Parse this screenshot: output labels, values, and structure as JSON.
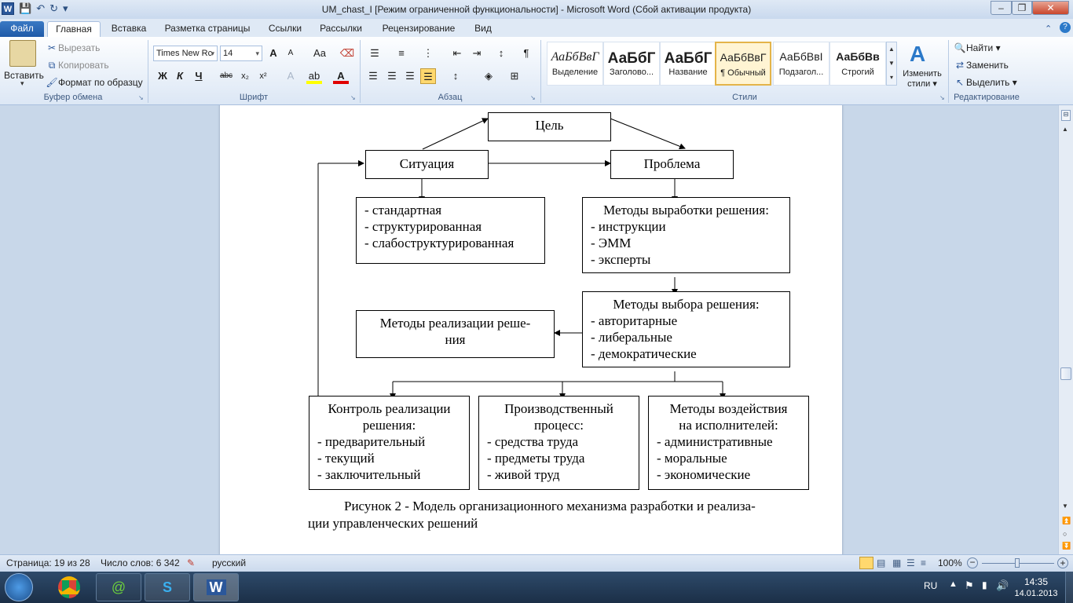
{
  "window": {
    "title": "UM_chast_I [Режим ограниченной функциональности]  -  Microsoft Word (Сбой активации продукта)",
    "app_logo": "W",
    "help": "?"
  },
  "tabs": [
    "Файл",
    "Главная",
    "Вставка",
    "Разметка страницы",
    "Ссылки",
    "Рассылки",
    "Рецензирование",
    "Вид"
  ],
  "ribbon": {
    "clipboard": {
      "paste": "Вставить",
      "cut": "Вырезать",
      "copy": "Копировать",
      "format_painter": "Формат по образцу",
      "label": "Буфер обмена"
    },
    "font": {
      "name": "Times New Rc",
      "size": "14",
      "label": "Шрифт",
      "bold": "Ж",
      "italic": "К",
      "underline": "Ч",
      "strike": "abc",
      "sub": "x₂",
      "sup": "x²",
      "grow": "A",
      "shrink": "A",
      "case": "Aa"
    },
    "paragraph": {
      "label": "Абзац",
      "pilcrow": "¶"
    },
    "styles": {
      "label": "Стили",
      "items": [
        {
          "preview": "АаБбВвГ",
          "name": "Выделение"
        },
        {
          "preview": "АаБбГ",
          "name": "Заголово..."
        },
        {
          "preview": "АаБбГ",
          "name": "Название"
        },
        {
          "preview": "АаБбВвГ",
          "name": "¶ Обычный"
        },
        {
          "preview": "АаБбВвІ",
          "name": "Подзагол..."
        },
        {
          "preview": "АаБбВв",
          "name": "Строгий"
        }
      ],
      "change_line1": "Изменить",
      "change_line2": "стили"
    },
    "editing": {
      "label": "Редактирование",
      "find": "Найти",
      "replace": "Заменить",
      "select": "Выделить"
    }
  },
  "diagram": {
    "goal": "Цель",
    "situation": "Ситуация",
    "problem": "Проблема",
    "situation_types": [
      "- стандартная",
      "- структурированная",
      "- слабоструктурированная"
    ],
    "development_methods": {
      "title": "Методы выработки решения:",
      "items": [
        "- инструкции",
        "- ЭММ",
        "- эксперты"
      ]
    },
    "choice_methods": {
      "title": "Методы выбора решения:",
      "items": [
        "- авторитарные",
        "- либеральные",
        "- демократические"
      ]
    },
    "implementation_methods": [
      "Методы реализации реше-",
      "ния"
    ],
    "control": {
      "title": [
        "Контроль реализации",
        "решения:"
      ],
      "items": [
        "- предварительный",
        "- текущий",
        "- заключительный"
      ]
    },
    "production": {
      "title": [
        "Производственный",
        "процесс:"
      ],
      "items": [
        "- средства труда",
        "- предметы труда",
        "- живой труд"
      ]
    },
    "influence": {
      "title": [
        "Методы воздействия",
        "на исполнителей:"
      ],
      "items": [
        "- административные",
        "- моральные",
        "- экономические"
      ]
    },
    "caption_line1": "Рисунок 2 - Модель организационного механизма разработки и реализа-",
    "caption_line2": "ции управленческих решений"
  },
  "statusbar": {
    "page": "Страница: 19 из 28",
    "words": "Число слов: 6 342",
    "language": "русский",
    "zoom": "100%"
  },
  "taskbar": {
    "lang": "RU",
    "time": "14:35",
    "date": "14.01.2013"
  }
}
